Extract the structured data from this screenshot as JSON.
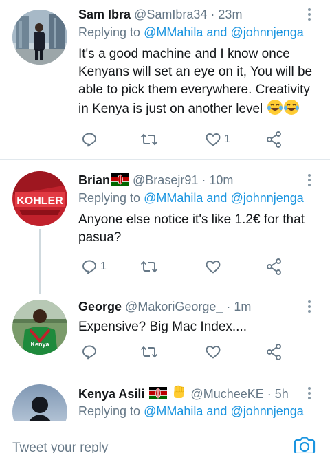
{
  "tweets": [
    {
      "name": "Sam Ibra",
      "handle": "@SamIbra34",
      "separator": "·",
      "time": "23m",
      "replying_prefix": "Replying to",
      "mention_1": "@MMahila",
      "mention_joiner": "and",
      "mention_2": "@johnnjenga",
      "text": "It's a good machine and I know once Kenyans will set an eye on it, You will be able to pick them everywhere. Creativity in Kenya is just on another level",
      "emojis": [
        "laughing-tears",
        "laughing-tears"
      ],
      "reply_count": "",
      "retweet_count": "",
      "like_count": "1"
    },
    {
      "name": "Brian",
      "handle": "@Brasejr91",
      "separator": "·",
      "time": "10m",
      "replying_prefix": "Replying to",
      "mention_1": "@MMahila",
      "mention_joiner": "and",
      "mention_2": "@johnnjenga",
      "text": "Anyone else notice it's like 1.2€ for that pasua?",
      "reply_count": "1",
      "retweet_count": "",
      "like_count": "",
      "flag": "kenya-flag-emoji",
      "avatar_text": "KOHLER"
    },
    {
      "name": "George",
      "handle": "@MakoriGeorge_",
      "separator": "·",
      "time": "1m",
      "text": "Expensive? Big Mac Index....",
      "reply_count": "",
      "retweet_count": "",
      "like_count": "",
      "avatar_text": "Kenya"
    },
    {
      "name": "Kenya Asili",
      "handle": "@MucheeKE",
      "separator": "·",
      "time": "5h",
      "replying_prefix": "Replying to",
      "mention_1": "@MMahila",
      "mention_joiner": "and",
      "mention_2": "@johnnjenga",
      "flag": "kenya-flag-emoji",
      "extra_emoji": "raised-fist-emoji"
    }
  ],
  "composer": {
    "placeholder": "Tweet your reply",
    "camera_icon": "camera-icon"
  },
  "colors": {
    "link": "#1b95e0",
    "secondary": "#657786",
    "divider": "#e1e8ed",
    "icon": "#657786"
  }
}
